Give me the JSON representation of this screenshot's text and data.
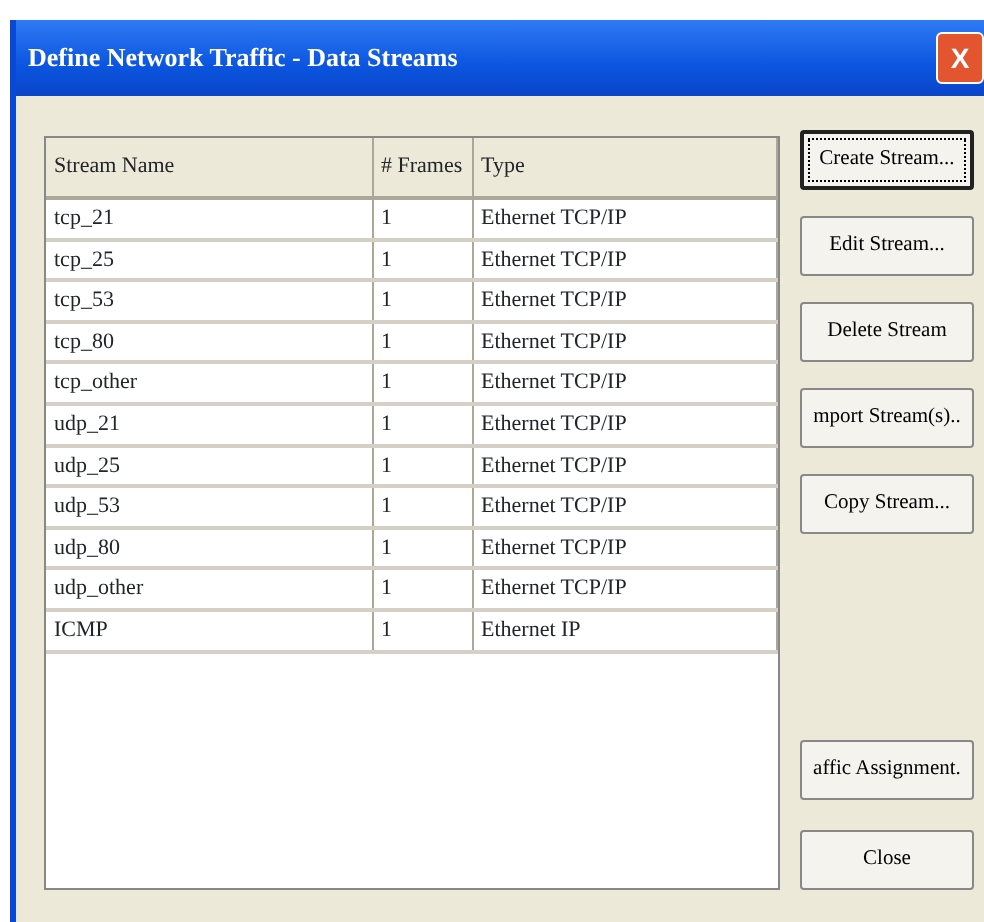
{
  "window": {
    "title": "Define Network Traffic - Data Streams",
    "close": "X"
  },
  "table": {
    "columns": [
      "Stream Name",
      "# Frames",
      "Type"
    ],
    "rows": [
      [
        "tcp_21",
        "1",
        "Ethernet TCP/IP"
      ],
      [
        "tcp_25",
        "1",
        "Ethernet TCP/IP"
      ],
      [
        "tcp_53",
        "1",
        "Ethernet TCP/IP"
      ],
      [
        "tcp_80",
        "1",
        "Ethernet TCP/IP"
      ],
      [
        "tcp_other",
        "1",
        "Ethernet TCP/IP"
      ],
      [
        "udp_21",
        "1",
        "Ethernet TCP/IP"
      ],
      [
        "udp_25",
        "1",
        "Ethernet TCP/IP"
      ],
      [
        "udp_53",
        "1",
        "Ethernet TCP/IP"
      ],
      [
        "udp_80",
        "1",
        "Ethernet TCP/IP"
      ],
      [
        "udp_other",
        "1",
        "Ethernet TCP/IP"
      ],
      [
        "ICMP",
        "1",
        "Ethernet IP"
      ]
    ]
  },
  "top_buttons": [
    {
      "label": "Create Stream...",
      "focused": true
    },
    {
      "label": "Edit Stream...",
      "focused": false
    },
    {
      "label": "Delete Stream",
      "focused": false
    },
    {
      "label": "mport Stream(s)..",
      "focused": false
    },
    {
      "label": "Copy Stream...",
      "focused": false
    }
  ],
  "bottom_buttons": [
    {
      "label": "affic Assignment.",
      "focused": false
    },
    {
      "label": "Close",
      "focused": false
    }
  ]
}
